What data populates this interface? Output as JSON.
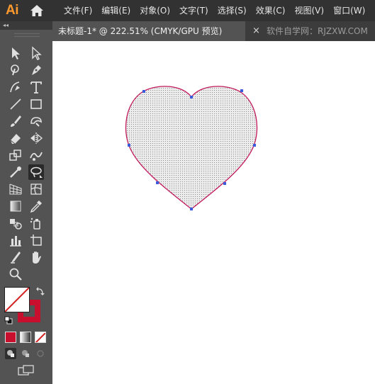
{
  "app": {
    "logo": "Ai"
  },
  "menu": [
    "文件(F)",
    "编辑(E)",
    "对象(O)",
    "文字(T)",
    "选择(S)",
    "效果(C)",
    "视图(V)",
    "窗口(W)"
  ],
  "document_tab": {
    "title": "未标题-1* @ 222.51% (CMYK/GPU 预览)",
    "close_glyph": "×"
  },
  "watermark": "软件自学网：RJZXW.COM",
  "panel": {
    "collapse_glyph": "◂◂"
  },
  "colors": {
    "menubar_bg": "#323232",
    "panel_bg": "#535353",
    "canvas_bg": "#ffffff",
    "heart_stroke": "#c2185b",
    "anchor_color": "#3b5bdb",
    "stroke_swatch": "#c8102e",
    "ai_logo": "#ff9a2e"
  },
  "tools": [
    "selection-tool",
    "direct-selection-tool",
    "magic-wand-tool",
    "pen-tool",
    "curvature-tool",
    "type-tool",
    "line-tool",
    "rectangle-tool",
    "paintbrush-tool",
    "shaper-tool",
    "eraser-tool",
    "reflect-tool",
    "scale-tool",
    "warp-tool",
    "puppet-warp-tool",
    "lasso-tool",
    "mesh-tool",
    "perspective-grid-tool",
    "gradient-tool",
    "eyedropper-tool",
    "blend-tool",
    "symbol-sprayer-tool",
    "column-graph-tool",
    "artboard-tool",
    "slice-tool",
    "hand-tool",
    "zoom-tool"
  ]
}
